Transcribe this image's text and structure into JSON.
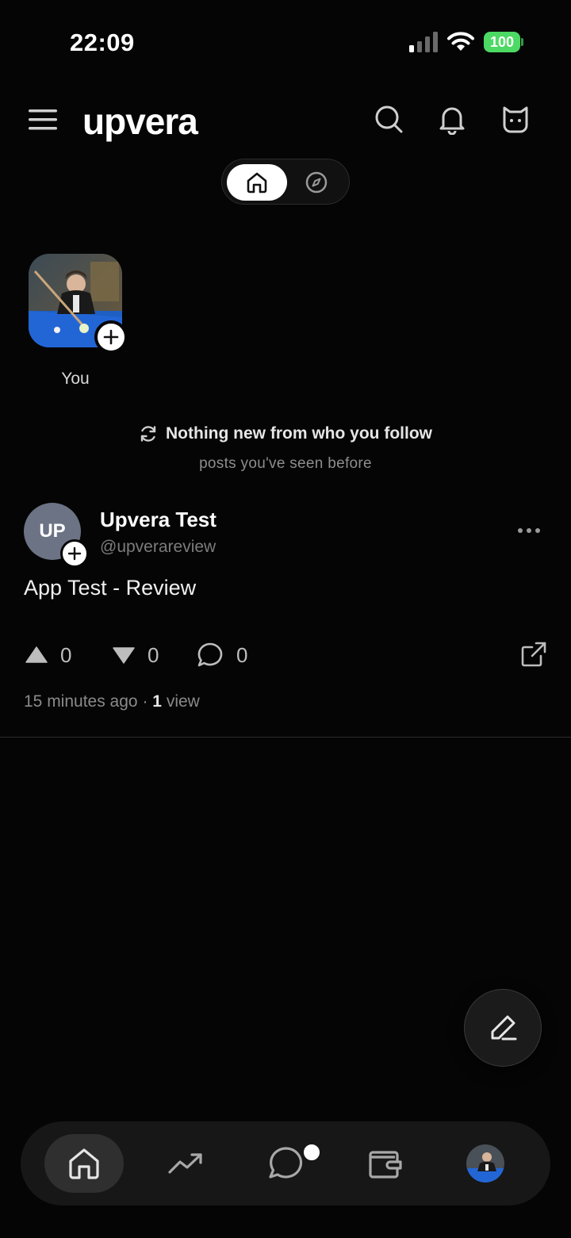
{
  "status_bar": {
    "time": "22:09",
    "battery": "100"
  },
  "header": {
    "brand": "upvera"
  },
  "story": {
    "label": "You"
  },
  "notice": {
    "title": "Nothing new from who you follow",
    "subtitle": "posts you've seen before"
  },
  "post": {
    "avatar_initials": "UP",
    "author_name": "Upvera Test",
    "author_handle": "@upverareview",
    "body": "App Test - Review",
    "upvotes": "0",
    "downvotes": "0",
    "comments": "0",
    "time_ago": "15 minutes ago",
    "separator": "·",
    "views_count": "1",
    "views_label": "view"
  },
  "tabs": [
    {
      "icon": "home-icon",
      "active": true
    },
    {
      "icon": "trending-icon"
    },
    {
      "icon": "chat-bubble-icon"
    },
    {
      "icon": "wallet-icon"
    },
    {
      "icon": "profile-avatar"
    }
  ],
  "colors": {
    "background": "#050505",
    "battery": "#4cd964",
    "avatar": "#6b7384",
    "tab_bar": "#171717"
  }
}
